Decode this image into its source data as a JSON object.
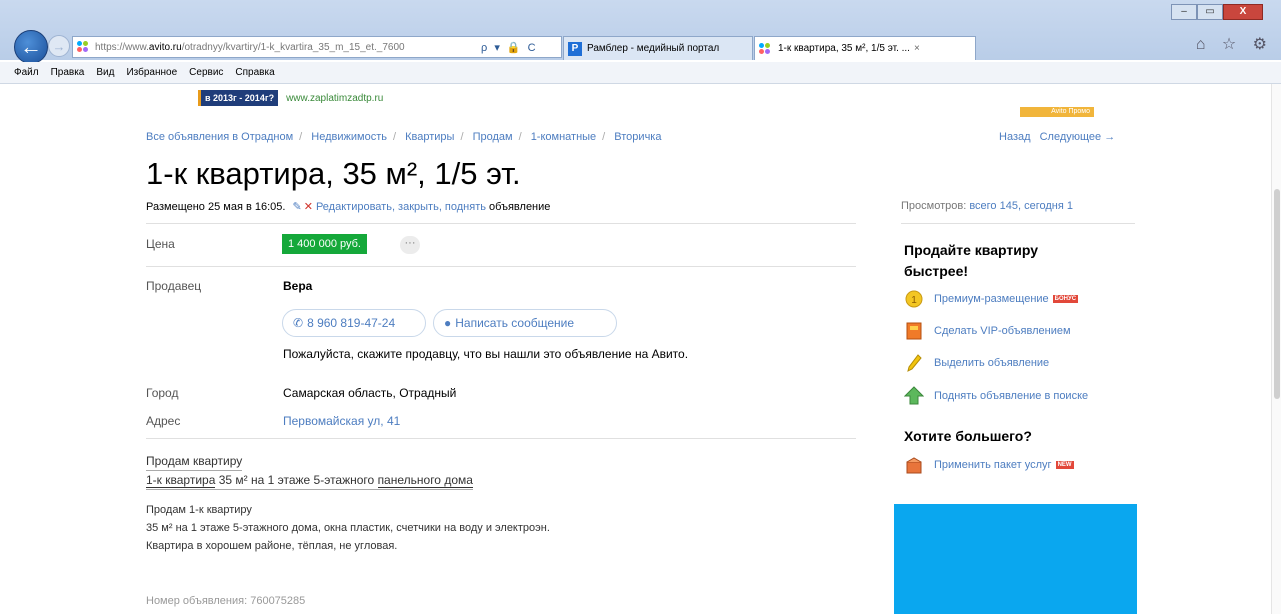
{
  "browser": {
    "url_prefix": "https://www.",
    "url_domain": "avito.ru",
    "url_rest": "/otradnyy/kvartiry/1-k_kvartira_35_m_15_et._7600",
    "address_controls": "ρ ▾ 🔒 C",
    "tabs": [
      {
        "label": "Рамблер - медийный портал"
      },
      {
        "label": "1-к квартира, 35 м², 1/5 эт. ...",
        "close": "×"
      }
    ],
    "menu": [
      "Файл",
      "Правка",
      "Вид",
      "Избранное",
      "Сервис",
      "Справка"
    ],
    "window_controls": [
      "–",
      "▭",
      "X"
    ],
    "tool_icons": "⌂ ☆ ⚙"
  },
  "banner": {
    "badge": "в 2013г - 2014г?",
    "link": "www.zaplatimzadtp.ru",
    "ad_label": "Avito Промо"
  },
  "breadcrumb": [
    "Все объявления в Отрадном",
    "Недвижимость",
    "Квартиры",
    "Продам",
    "1-комнатные",
    "Вторичка"
  ],
  "pager": {
    "back": "Назад",
    "next": "Следующее →"
  },
  "listing": {
    "title": "1-к квартира, 35 м², 1/5 эт.",
    "posted": "Размещено 25 мая в 16:05.",
    "edit_links": "Редактировать, закрыть, поднять",
    "edit_suffix": "объявление",
    "views_label": "Просмотров:",
    "views_value": "всего 145, сегодня 1",
    "price_label": "Цена",
    "price": "1 400 000 руб.",
    "price_more": "···",
    "seller_label": "Продавец",
    "seller_name": "Вера",
    "phone": "8 960 819-47-24",
    "message_btn": "Написать сообщение",
    "hint": "Пожалуйста, скажите продавцу, что вы нашли это объявление на Авито.",
    "city_label": "Город",
    "city": "Самарская область, Отрадный",
    "address_label": "Адрес",
    "address": "Первомайская ул, 41",
    "desc_head": "Продам квартиру",
    "desc_sub_pre": "1-к квартира",
    "desc_sub_mid": " 35 м² на 1 этаже 5-этажного ",
    "desc_sub_post": "панельного дома",
    "desc_lines": [
      "Продам 1-к квартиру",
      "35 м² на 1 этаже 5-этажного дома, окна пластик, счетчики на воду и электроэн.",
      "Квартира в хорошем районе, тёплая, не угловая."
    ],
    "ad_number": "Номер объявления: 760075285"
  },
  "sidebar": {
    "title": "Продайте квартиру быстрее!",
    "items": [
      {
        "label": "Премиум-размещение",
        "badge": "БОНУС",
        "icon": "premium-icon"
      },
      {
        "label": "Сделать VIP-объявлением",
        "icon": "vip-icon"
      },
      {
        "label": "Выделить объявление",
        "icon": "highlight-icon"
      },
      {
        "label": "Поднять объявление в поиске",
        "icon": "lift-icon"
      }
    ],
    "title2": "Хотите большего?",
    "package": {
      "label": "Применить пакет услуг",
      "badge": "NEW"
    }
  },
  "colors": {
    "link": "#4d7dc0",
    "price_bg": "#15a83a",
    "ad_block": "#0aa7ef"
  }
}
